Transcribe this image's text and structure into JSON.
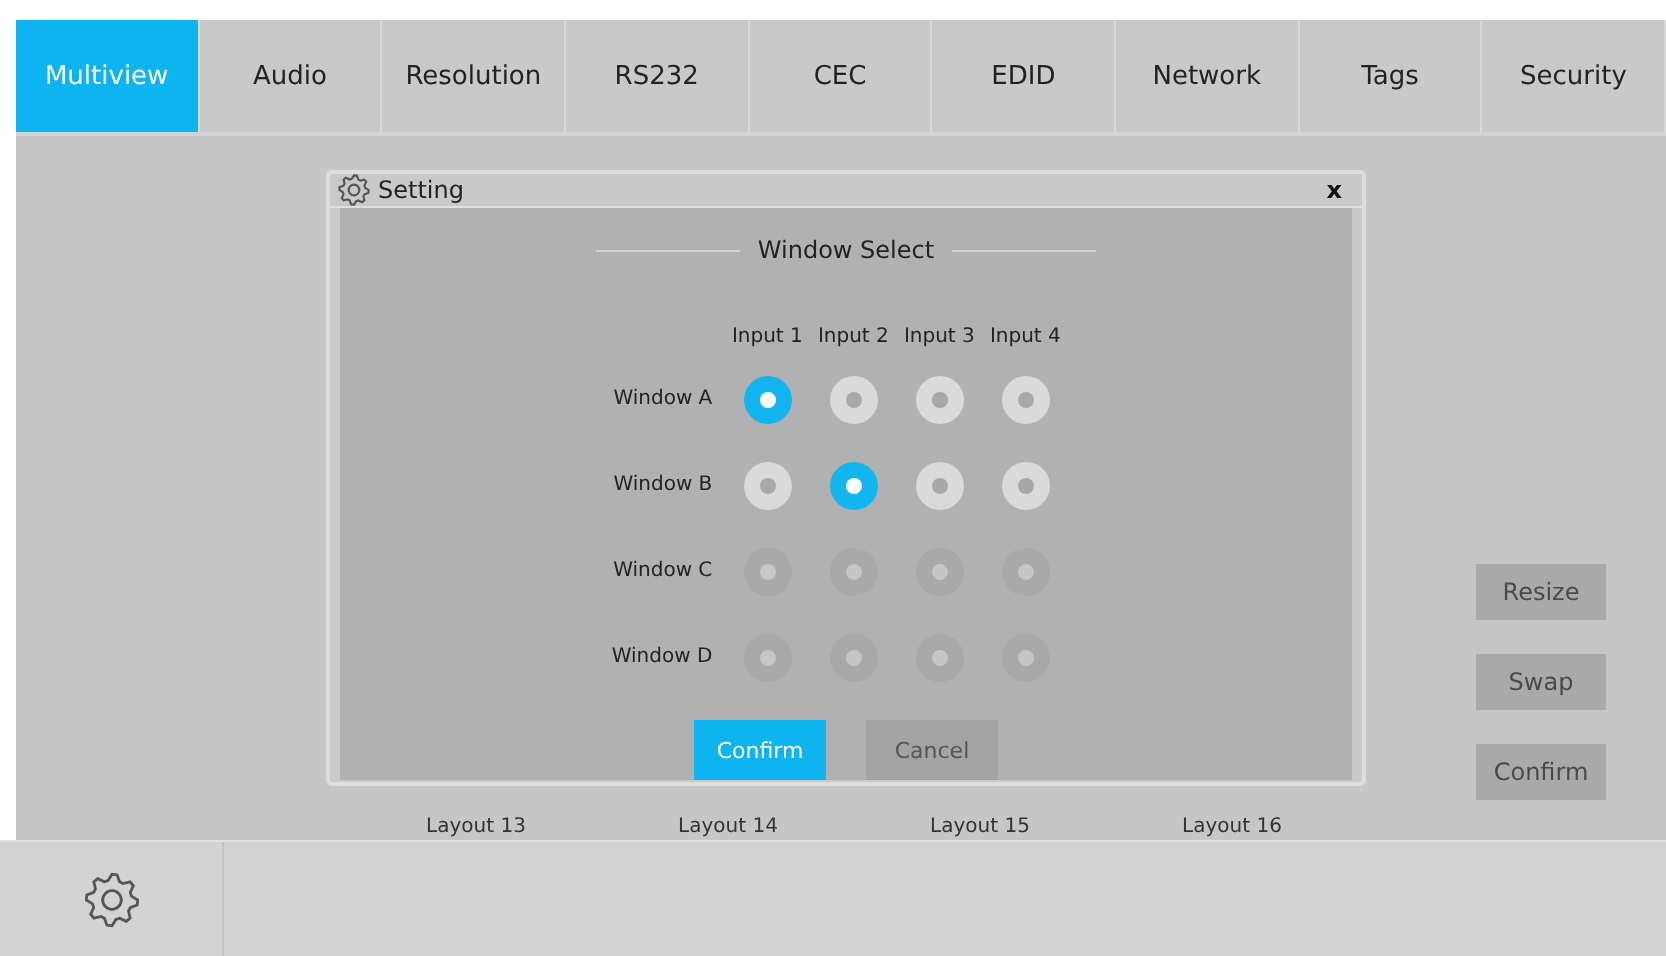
{
  "tabs": [
    {
      "label": "Multiview",
      "selected": true
    },
    {
      "label": "Audio",
      "selected": false
    },
    {
      "label": "Resolution",
      "selected": false
    },
    {
      "label": "RS232",
      "selected": false
    },
    {
      "label": "CEC",
      "selected": false
    },
    {
      "label": "EDID",
      "selected": false
    },
    {
      "label": "Network",
      "selected": false
    },
    {
      "label": "Tags",
      "selected": false
    },
    {
      "label": "Security",
      "selected": false
    }
  ],
  "layouts": [
    "Layout 13",
    "Layout 14",
    "Layout 15",
    "Layout 16"
  ],
  "side_buttons": [
    "Resize",
    "Swap",
    "Confirm"
  ],
  "dialog": {
    "title": "Setting",
    "close": "x",
    "heading": "Window Select",
    "columns": [
      "Input 1",
      "Input 2",
      "Input 3",
      "Input 4"
    ],
    "rows": [
      {
        "label": "Window A",
        "disabled": false,
        "inputs": [
          {
            "selected": true
          },
          {
            "selected": false
          },
          {
            "selected": false
          },
          {
            "selected": false
          }
        ]
      },
      {
        "label": "Window B",
        "disabled": false,
        "inputs": [
          {
            "selected": false
          },
          {
            "selected": true
          },
          {
            "selected": false
          },
          {
            "selected": false
          }
        ]
      },
      {
        "label": "Window C",
        "disabled": true,
        "inputs": [
          {
            "selected": false
          },
          {
            "selected": false
          },
          {
            "selected": false
          },
          {
            "selected": false
          }
        ]
      },
      {
        "label": "Window D",
        "disabled": true,
        "inputs": [
          {
            "selected": false
          },
          {
            "selected": false
          },
          {
            "selected": false
          },
          {
            "selected": false
          }
        ]
      }
    ],
    "buttons": [
      {
        "label": "Confirm",
        "kind": "primary"
      },
      {
        "label": "Cancel",
        "kind": "secondary"
      }
    ]
  }
}
